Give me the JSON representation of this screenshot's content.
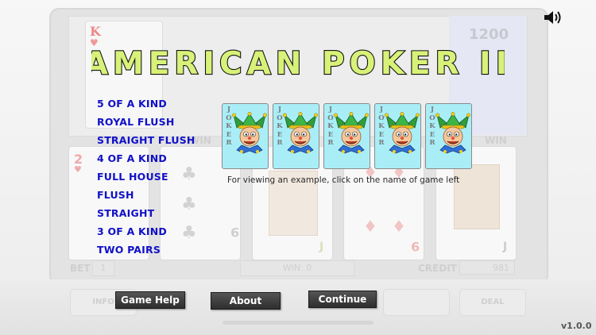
{
  "title": "AMERICAN POKER II",
  "games": [
    "5 OF A KIND",
    "ROYAL FLUSH",
    "STRAIGHT FLUSH",
    "4 OF A KIND",
    "FULL HOUSE",
    "FLUSH",
    "STRAIGHT",
    "3 OF A KIND",
    "TWO PAIRS"
  ],
  "joker_cards": [
    "JOKER",
    "JOKER",
    "JOKER",
    "JOKER",
    "JOKER"
  ],
  "hint": "For viewing an example, click on the name of game left",
  "buttons": {
    "help": "Game Help",
    "about": "About",
    "continue": "Continue"
  },
  "version": "v1.0.0",
  "background": {
    "credit_amount": "1200",
    "bet_label": "BET",
    "bet_value": "1",
    "win_label": "WIN: 0",
    "credit_label": "CREDIT",
    "credit_value": "981",
    "info_button": "INFO",
    "deal_button": "DEAL",
    "win_word_left": "WIN",
    "win_word_right": "WIN"
  },
  "colors": {
    "title_fill": "#d8f279",
    "title_outline": "#111111",
    "list_text": "#1010c8",
    "card_bg": "#a9eef7",
    "button_bg": "#3a3a3a"
  },
  "icons": {
    "sound": "speaker-icon",
    "joker": "joker-face-icon"
  }
}
